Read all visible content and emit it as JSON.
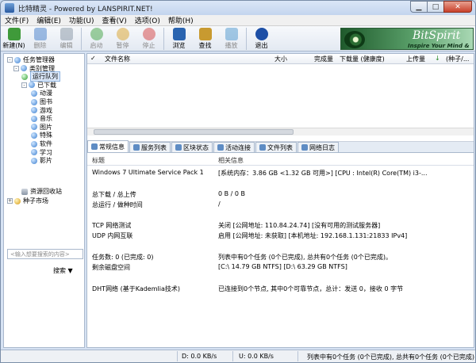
{
  "window": {
    "title": "比特精灵 - Powered by LANSPIRIT.NET!"
  },
  "menu": [
    "文件(F)",
    "编辑(E)",
    "功能(U)",
    "查看(V)",
    "选项(O)",
    "帮助(H)"
  ],
  "toolbar": [
    {
      "label": "新建(N)",
      "icon": "new-icon",
      "color": "#3f9a3a",
      "enabled": true
    },
    {
      "label": "删除",
      "icon": "delete-icon",
      "color": "#2f6fc4",
      "enabled": false
    },
    {
      "label": "编辑",
      "icon": "edit-icon",
      "color": "#7a8a9a",
      "enabled": false
    },
    {
      "label": "启动",
      "icon": "start-icon",
      "color": "#2c9a2c",
      "enabled": false
    },
    {
      "label": "暂停",
      "icon": "pause-icon",
      "color": "#d69a12",
      "enabled": false
    },
    {
      "label": "停止",
      "icon": "stop-icon",
      "color": "#d02c2c",
      "enabled": false
    },
    {
      "label": "浏览",
      "icon": "browse-icon",
      "color": "#2a64b0",
      "enabled": true
    },
    {
      "label": "查找",
      "icon": "find-icon",
      "color": "#c89a30",
      "enabled": true
    },
    {
      "label": "播放",
      "icon": "play-icon",
      "color": "#3a8cc8",
      "enabled": false
    },
    {
      "label": "退出",
      "icon": "exit-icon",
      "color": "#1d4fa6",
      "enabled": true
    }
  ],
  "banner": {
    "title": "BitSpirit",
    "slogan": "Inspire Your Mind & Spirit"
  },
  "tree": [
    {
      "label": "任务管理器",
      "level": 0,
      "exp": "-",
      "icon": "blue"
    },
    {
      "label": "类别管理",
      "level": 1,
      "exp": "-",
      "icon": "blue"
    },
    {
      "label": "运行队列",
      "level": 2,
      "exp": "",
      "icon": "green",
      "selected": true
    },
    {
      "label": "已下载",
      "level": 2,
      "exp": "-",
      "icon": "blue"
    },
    {
      "label": "动漫",
      "level": 3,
      "exp": "",
      "icon": "blue"
    },
    {
      "label": "图书",
      "level": 3,
      "exp": "",
      "icon": "blue"
    },
    {
      "label": "游戏",
      "level": 3,
      "exp": "",
      "icon": "blue"
    },
    {
      "label": "音乐",
      "level": 3,
      "exp": "",
      "icon": "blue"
    },
    {
      "label": "图片",
      "level": 3,
      "exp": "",
      "icon": "blue"
    },
    {
      "label": "特殊",
      "level": 3,
      "exp": "",
      "icon": "blue"
    },
    {
      "label": "软件",
      "level": 3,
      "exp": "",
      "icon": "blue"
    },
    {
      "label": "学习",
      "level": 3,
      "exp": "",
      "icon": "blue"
    },
    {
      "label": "影片",
      "level": 3,
      "exp": "",
      "icon": "blue"
    },
    {
      "label": "资源回收站",
      "level": 2,
      "exp": "",
      "icon": "trash"
    },
    {
      "label": "种子市场",
      "level": 0,
      "exp": "+",
      "icon": "yellow"
    }
  ],
  "search": {
    "placeholder": "<输入想要搜索的内容>",
    "button": "搜索"
  },
  "list_header": {
    "name": "文件名称",
    "size": "大小",
    "done": "完成量",
    "speed": "下载量 (健康度)",
    "upload": "上传量",
    "seeds": "(种子/...",
    "sort_arrow": "↓"
  },
  "tabs": [
    "常规信息",
    "服务列表",
    "区块状态",
    "活动连接",
    "文件列表",
    "网络日志"
  ],
  "info_header": {
    "title": "标题",
    "detail": "相关信息"
  },
  "info_rows": [
    {
      "label": "Windows 7 Ultimate Service Pack 1",
      "value": "[系统内存：3.86 GB <1.32 GB 可用>] [CPU : Intel(R) Core(TM) i3-..."
    },
    {
      "label": "总下载 / 总上传",
      "value": "0 B / 0 B"
    },
    {
      "label": "总运行 / 做种时间",
      "value": "/"
    },
    {
      "label": "TCP 网络测试",
      "value": "关闭 [公网地址: 110.84.24.74] [没有可用的测试服务器]"
    },
    {
      "label": "UDP 内网互联",
      "value": "启用 [公网地址: 未获取] [本机地址: 192.168.1.131:21833 IPv4]"
    },
    {
      "label": "任务数: 0 (已完成: 0)",
      "value": "列表中有0个任务 (0个已完成), 总共有0个任务 (0个已完成)。"
    },
    {
      "label": "剩余磁盘空间",
      "value": "[C:\\  14.79 GB   NTFS]   [D:\\  63.29 GB   NTFS]"
    },
    {
      "label": "DHT网络 (基于Kademlia技术)",
      "value": "已连接到0个节点, 其中0个可靠节点，总计：发送 0，接收 0 字节"
    }
  ],
  "status": {
    "down": "D: 0.0 KB/s",
    "up": "U: 0.0 KB/s",
    "summary": "列表中有0个任务 (0个已完成), 总共有0个任务 (0个已完成)"
  }
}
